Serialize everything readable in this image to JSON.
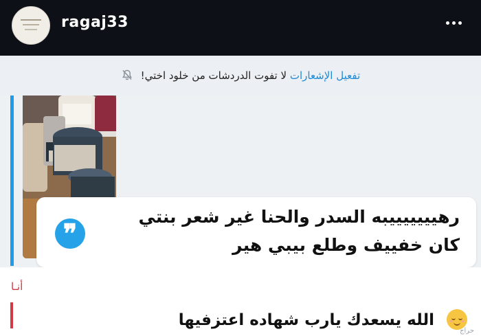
{
  "header": {
    "username": "ragaj33",
    "menu_icon": "more-horizontal-icon"
  },
  "notice": {
    "link_text": "تفعيل الإشعارات",
    "message": "لا تفوت الدردشات من خلود اختي!",
    "icon": "bell-off-icon"
  },
  "quote": {
    "text": "رهيييييييبه السدر والحنا غير شعر بنتي كان خفييف وطلع بيبي هير",
    "badge_icon": "quote-icon"
  },
  "reply": {
    "author_label": "أنـا",
    "text": "الله يسعدك يارب شهاده اعتزفيها",
    "emoji": "relieved-face-icon"
  },
  "watermark": "حراج",
  "colors": {
    "topbar": "#0d1117",
    "accent_blue": "#1e9be9",
    "reply_red": "#d23b45",
    "notice_bg": "#eceff3"
  }
}
